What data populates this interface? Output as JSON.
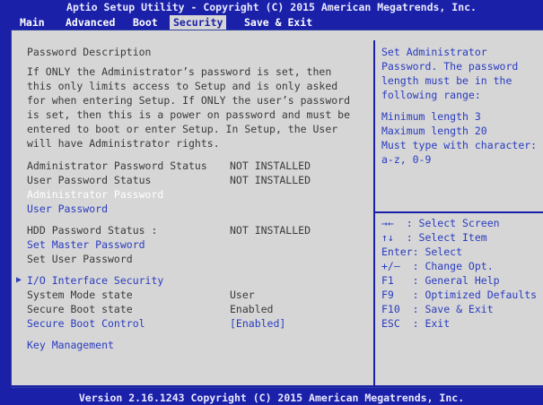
{
  "title": "Aptio Setup Utility - Copyright (C) 2015 American Megatrends, Inc.",
  "tabs": [
    "Main",
    "Advanced",
    "Boot",
    "Security",
    "Save & Exit"
  ],
  "left": {
    "password_description_heading": "Password Description",
    "description_lines": [
      "If ONLY the Administrator’s password is set, then",
      "this only limits access to Setup and is only asked",
      "for when entering Setup. If ONLY the user’s password",
      "is set, then this is a power on password and must be",
      "entered to boot or enter Setup. In Setup, the User",
      "will have Administrator rights."
    ],
    "admin_status_label": "Administrator Password Status",
    "admin_status_value": "NOT INSTALLED",
    "user_status_label": "User Password Status",
    "user_status_value": "NOT INSTALLED",
    "admin_password": "Administrator Password",
    "user_password": "User Password",
    "hdd_status_label": "HDD Password Status :",
    "hdd_status_value": "NOT INSTALLED",
    "set_master_password": "Set Master Password",
    "set_user_password": "Set User Password",
    "io_interface_security": "I/O Interface Security",
    "system_mode_label": "System Mode state",
    "system_mode_value": "User",
    "secure_boot_state_label": "Secure Boot state",
    "secure_boot_state_value": "Enabled",
    "secure_boot_control_label": "Secure Boot Control",
    "secure_boot_control_value": "[Enabled]",
    "key_management": "Key Management"
  },
  "help": {
    "lines": [
      "Set Administrator",
      "Password. The password",
      "length must be in the",
      "following range:"
    ],
    "range_lines": [
      "Minimum length 3",
      "Maximum length 20",
      "Must type with character:",
      "a-z, 0-9"
    ]
  },
  "keys": [
    "→←  : Select Screen",
    "↑↓  : Select Item",
    "Enter: Select",
    "+/—  : Change Opt.",
    "F1   : General Help",
    "F9   : Optimized Defaults",
    "F10  : Save & Exit",
    "ESC  : Exit"
  ],
  "footer": "Version 2.16.1243 Copyright (C) 2015 American Megatrends, Inc.",
  "colors": {
    "background": "#1a20a8",
    "panel": "#d6d6d6",
    "link": "#2a3cbf",
    "text": "#3a3a3a",
    "highlight": "#ffffff"
  }
}
